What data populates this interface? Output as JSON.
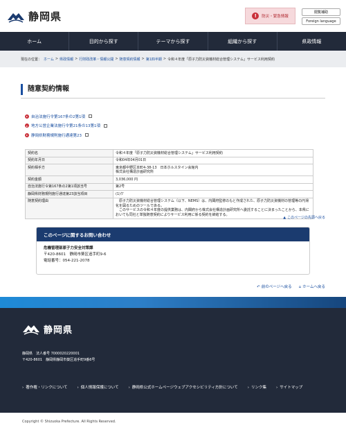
{
  "header": {
    "logo_text": "静岡県",
    "alert_button": "防災・緊急情報",
    "alert_icon": "!",
    "util_buttons": [
      "閲覧補助",
      "Foreign language"
    ]
  },
  "gnav": [
    "ホーム",
    "目的から探す",
    "テーマから探す",
    "組織から探す",
    "県政情報"
  ],
  "breadcrumb": {
    "prefix": "現在の位置：",
    "items": [
      "ホーム",
      "県政情報",
      "行財政改革・情報公開",
      "随意契約情報",
      "第1四半期",
      "令和４年度「原子力防災資機材総合管理システム」サービス利用契約"
    ]
  },
  "page": {
    "title": "随意契約情報",
    "links": [
      "自治法施行令第167条の2第1項",
      "地方公営企業法施行令第21条の13第1項",
      "静岡県財務規則施行通達第23"
    ],
    "table": [
      {
        "k": "契約名",
        "v": "令和４年度「原子力防災資機材総合管理システム」サービス利用契約"
      },
      {
        "k": "契約年月日",
        "v": "令和04年04月01日"
      },
      {
        "k": "契約相手方",
        "v": "東京都中野区本町4-38-13　日本ホルスタイン会館内\n株式会社構造計画研究所"
      },
      {
        "k": "契約金額",
        "v": "3,036,000 円"
      },
      {
        "k": "自治法施行令第167条の2第1項該当号",
        "v": "第2号"
      },
      {
        "k": "静岡県財務規則施行通達第23該当項目",
        "v": "(1)ケ"
      },
      {
        "k": "随意契約理由",
        "v": "　原子力防災資機材総合管理システム（以下、NEMS）は、内閣府監修のもと作成された、原子力防災資機材の管理等の円滑化を図るためのツールである。\n　このサービスの令和４年度の提供業務は、内閣府から株式会社構造計画研究所へ委託することに決まったことから、本県においても同社と単独随意契約によりサービス利用に係る契約を締結する。"
      }
    ],
    "to_top": "このページの先頭へ戻る"
  },
  "contact": {
    "heading": "このページに関するお問い合わせ",
    "dept": "危機管理部原子力安全対策課",
    "address": "〒420-8601　静岡市葵区追手町9-6",
    "phone": "電話番号：054-221-2078"
  },
  "bottom_links": [
    "前のページへ戻る",
    "ホームへ戻る"
  ],
  "footer": {
    "logo_text": "静岡県",
    "addr1": "静岡県　法人番号 7000020220001",
    "addr2": "〒420-8601　静岡県静岡市葵区追手町9番6号",
    "links": [
      "著作権・リンクについて",
      "個人情報保護について",
      "静岡県公式ホームページウェブアクセシビリティ方針について",
      "リンク集",
      "サイトマップ"
    ],
    "copyright": "Copyright © Shizuoka Prefecture. All Rights Reserved."
  },
  "colors": {
    "nav_bg": "#222a3a",
    "accent": "#1a4fa0",
    "alert": "#c9303a",
    "contact_head": "#1b3b6f"
  }
}
